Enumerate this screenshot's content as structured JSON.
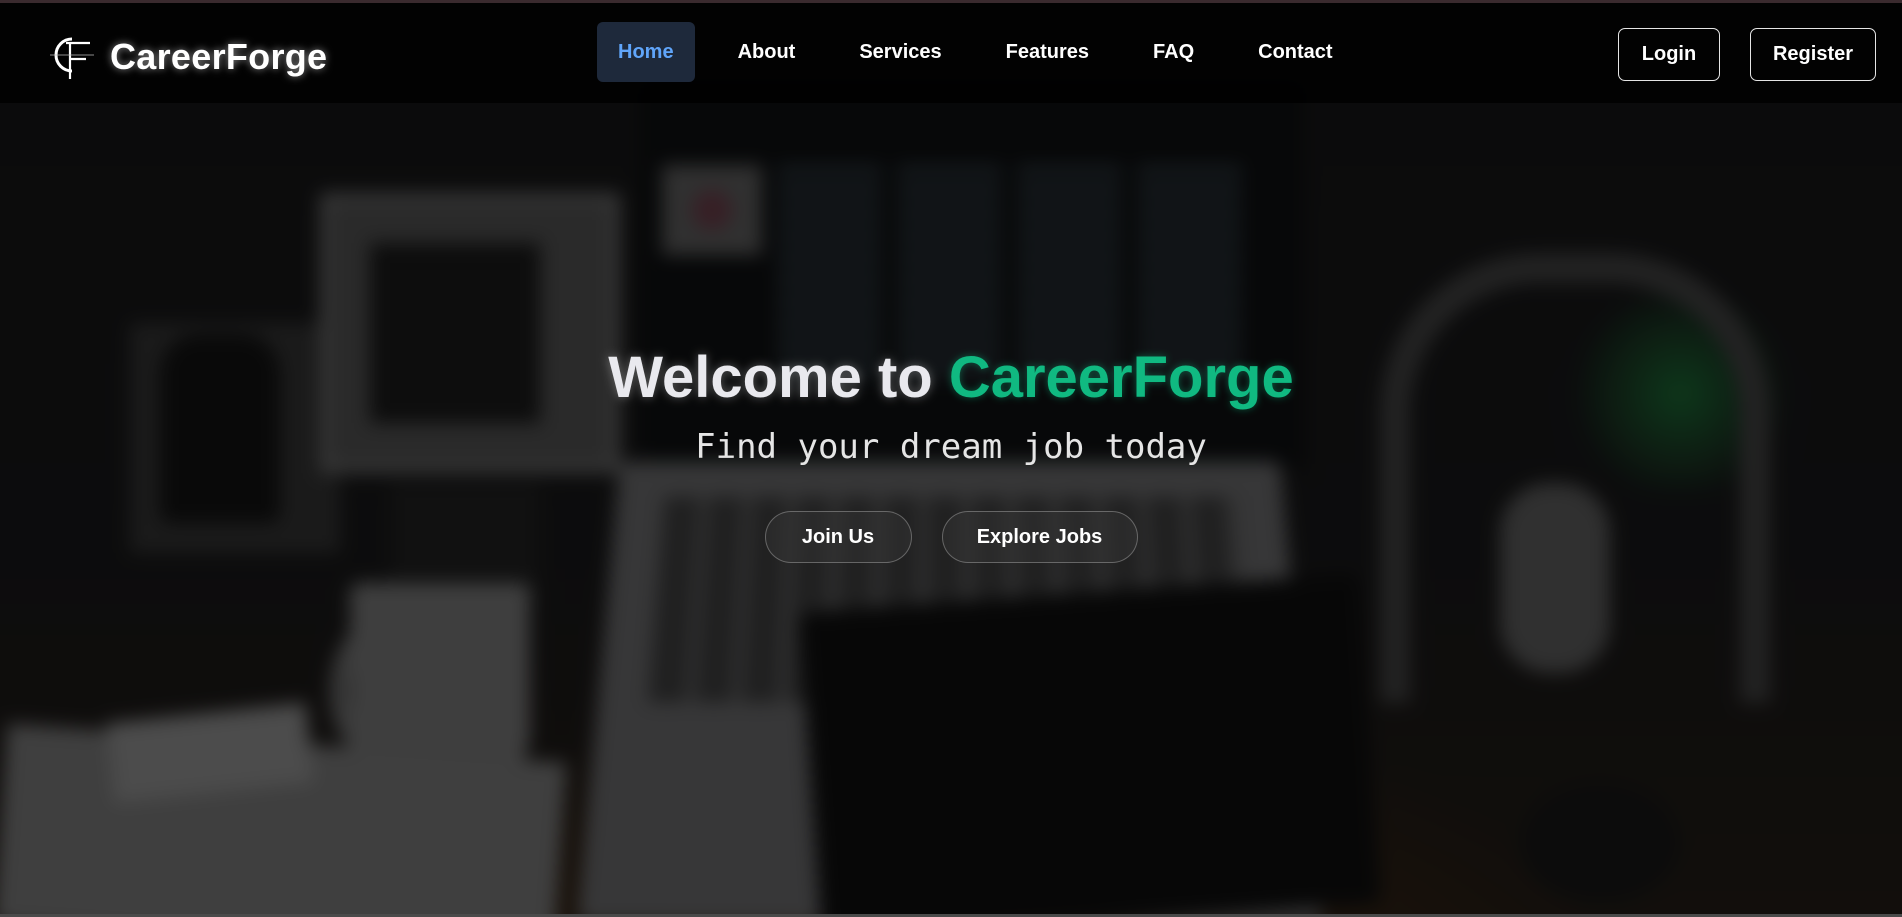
{
  "brand": {
    "name": "CareerForge",
    "logo_icon": "cf-monogram-icon"
  },
  "nav": {
    "items": [
      {
        "label": "Home",
        "active": true
      },
      {
        "label": "About",
        "active": false
      },
      {
        "label": "Services",
        "active": false
      },
      {
        "label": "Features",
        "active": false
      },
      {
        "label": "FAQ",
        "active": false
      },
      {
        "label": "Contact",
        "active": false
      }
    ],
    "active_color": "#60a5fa",
    "active_bg": "#1e293b"
  },
  "auth": {
    "login_label": "Login",
    "register_label": "Register"
  },
  "hero": {
    "title_prefix": "Welcome to ",
    "title_accent": "CareerForge",
    "subtitle": "Find your dream job today",
    "join_label": "Join Us",
    "explore_label": "Explore Jobs",
    "accent_color": "#10b981"
  }
}
